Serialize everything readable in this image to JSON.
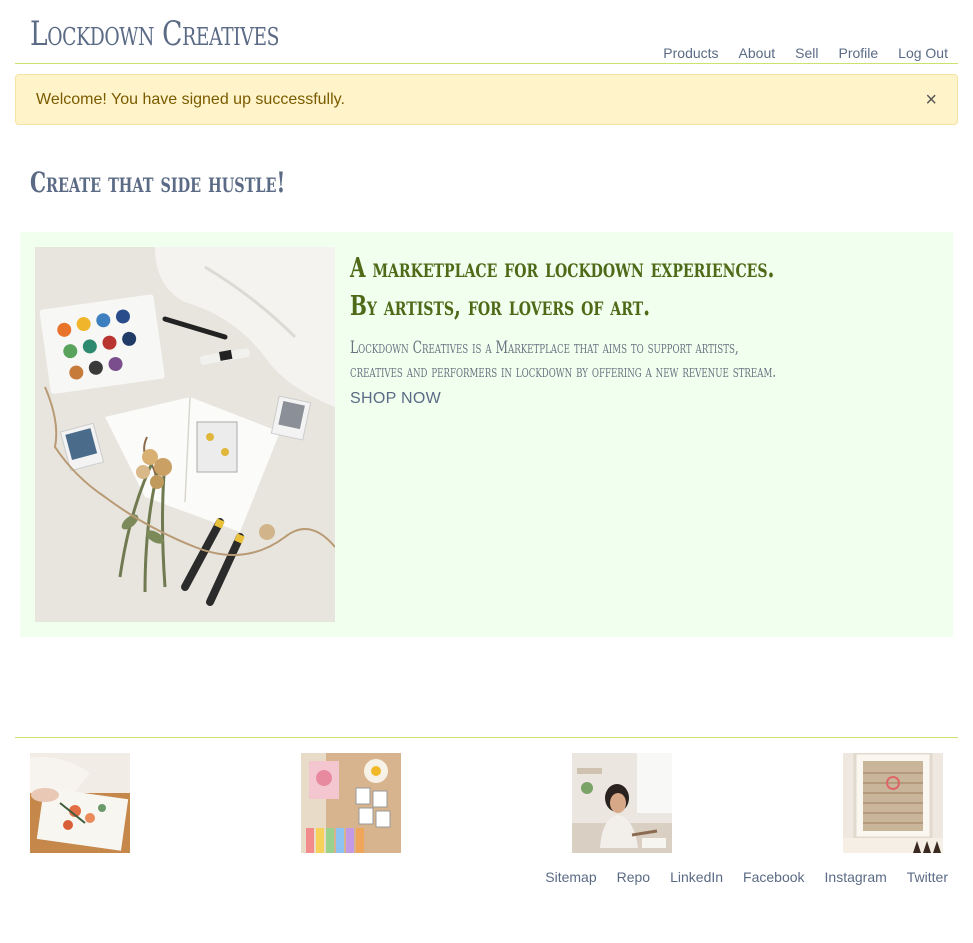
{
  "header": {
    "brand": "Lockdown Creatives",
    "nav": [
      "Products",
      "About",
      "Sell",
      "Profile",
      "Log Out"
    ]
  },
  "alert": {
    "message": "Welcome! You have signed up successfully.",
    "close": "×"
  },
  "page_title": "Create that side hustle!",
  "hero": {
    "heading_line1": "A marketplace for lockdown experiences.",
    "heading_line2": "By artists, for lovers of art.",
    "description": "Lockdown Creatives is a Marketplace that aims to support artists, creatives and performers in lockdown by offering a new revenue stream.",
    "cta": "SHOP NOW"
  },
  "footer": {
    "links": [
      "Sitemap",
      "Repo",
      "LinkedIn",
      "Facebook",
      "Instagram",
      "Twitter"
    ]
  },
  "colors": {
    "accent_line": "#c9e36b",
    "link": "#5b6b85",
    "hero_bg": "#f0ffee",
    "hero_heading": "#4e6a18",
    "alert_bg": "#fff3c9"
  }
}
